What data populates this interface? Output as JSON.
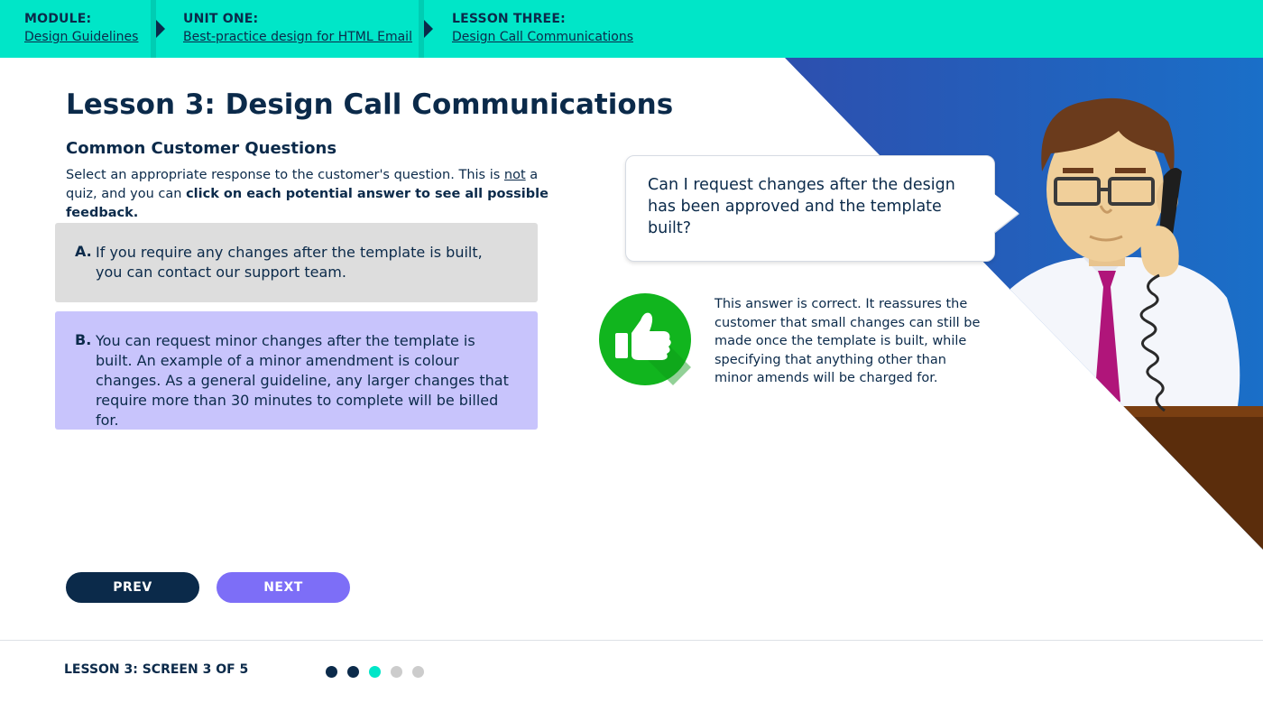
{
  "breadcrumbs": [
    {
      "label": "MODULE:",
      "link": "Design Guidelines"
    },
    {
      "label": "UNIT ONE:",
      "link": "Best-practice design for HTML Email"
    },
    {
      "label": "LESSON THREE:",
      "link": "Design Call Communications"
    }
  ],
  "lesson": {
    "title": "Lesson 3: Design Call Communications",
    "subtitle": "Common Customer Questions",
    "instructions": {
      "part1": "Select an appropriate response to the customer's question. This is ",
      "emph": "not",
      "part2": " a quiz, and you can ",
      "bold": "click on each potential answer to see all possible feedback."
    }
  },
  "answers": [
    {
      "letter": "A.",
      "text": "If you require any changes after the template is built, you can contact our support team."
    },
    {
      "letter": "B.",
      "text": "You can request minor changes after the template is built. An example of a minor amendment is colour changes. As a general guideline, any larger changes that require more than 30 minutes to complete will be billed for."
    }
  ],
  "question": "Can I request changes after the design has been approved and the template built?",
  "feedback": {
    "icon": "thumbs-up-icon",
    "text": "This answer is correct. It reassures the customer that small changes can still be made once the template is built, while specifying that anything other than minor amends will be charged for."
  },
  "nav": {
    "prev": "PREV",
    "next": "NEXT"
  },
  "footer": {
    "screen_label": "LESSON 3: SCREEN 3 OF 5",
    "total_screens": 5,
    "current_screen": 3
  },
  "colors": {
    "topbar": "#00e6c8",
    "navy": "#0b2a4a",
    "answer_a_bg": "#dddddd",
    "answer_b_bg": "#c8c4fc",
    "next_button": "#7d6ef7",
    "correct_green": "#11b51e",
    "dot_done": "#0b2a4a",
    "dot_current": "#00e6c8",
    "dot_todo": "#cccccc"
  }
}
